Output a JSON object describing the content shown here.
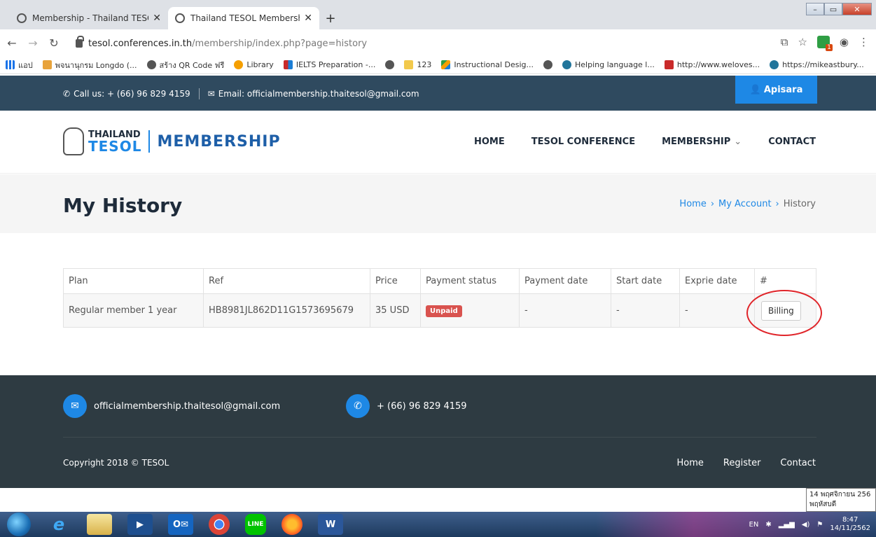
{
  "browser": {
    "tabs": [
      {
        "title": "Membership - Thailand TESOL A",
        "active": false
      },
      {
        "title": "Thailand TESOL Membership",
        "active": true
      }
    ],
    "new_tab": "+",
    "url_host": "tesol.conferences.in.th",
    "url_path": "/membership/index.php?page=history",
    "bookmarks": [
      "แอป",
      "พจนานุกรม Longdo (...",
      "สร้าง QR Code ฟรี",
      "Library",
      "IELTS Preparation -...",
      "123",
      "Instructional Desig...",
      "Helping language l...",
      "http://www.weloves...",
      "https://mikeastbury..."
    ],
    "extension_badge": "1"
  },
  "topbar": {
    "phone": "Call us: + (66) 96 829 4159",
    "email": "Email: officialmembership.thaitesol@gmail.com",
    "user": "Apisara"
  },
  "logo": {
    "line1": "THAILAND",
    "line2": "TESOL",
    "line3": "MEMBERSHIP"
  },
  "nav": {
    "items": [
      "HOME",
      "TESOL CONFERENCE",
      "MEMBERSHIP",
      "CONTACT"
    ]
  },
  "page": {
    "title": "My History",
    "breadcrumb": [
      "Home",
      "My Account",
      "History"
    ]
  },
  "table": {
    "headers": [
      "Plan",
      "Ref",
      "Price",
      "Payment status",
      "Payment date",
      "Start date",
      "Exprie date",
      "#"
    ],
    "rows": [
      {
        "plan": "Regular member 1 year",
        "ref": "HB8981JL862D11G1573695679",
        "price": "35 USD",
        "status": "Unpaid",
        "payment_date": "-",
        "start_date": "-",
        "expire_date": "-",
        "action": "Billing"
      }
    ]
  },
  "footer": {
    "email": "officialmembership.thaitesol@gmail.com",
    "phone": "+ (66) 96 829 4159",
    "copyright": "Copyright 2018 © TESOL",
    "links": [
      "Home",
      "Register",
      "Contact"
    ]
  },
  "tooltip": {
    "line1": "14 พฤศจิกายน 256",
    "line2": "พฤหัสบดี"
  },
  "taskbar": {
    "lang": "EN",
    "time": "8:47",
    "date": "14/11/2562"
  },
  "colors": {
    "topbar": "#2f4a5f",
    "accent": "#1e88e5",
    "badge_unpaid": "#d9534f",
    "footer": "#2e3b42",
    "highlight": "#e0252a"
  }
}
